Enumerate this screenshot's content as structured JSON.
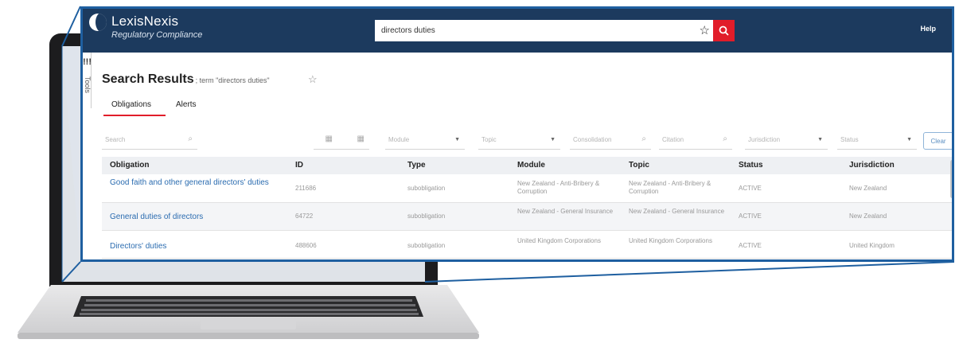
{
  "header": {
    "brand_name": "LexisNexis",
    "brand_sub": "Regulatory Compliance",
    "search_value": "directors duties",
    "help_label": "Help"
  },
  "side": {
    "mark": "!!!",
    "label": "Tools"
  },
  "page": {
    "title": "Search Results",
    "term": "; term \"directors duties\""
  },
  "tabs": [
    {
      "label": "Obligations"
    },
    {
      "label": "Alerts"
    }
  ],
  "filters": {
    "search": "Search",
    "module": "Module",
    "topic": "Topic",
    "consolidation": "Consolidation",
    "citation": "Citation",
    "jurisdiction": "Jurisdiction",
    "status": "Status",
    "clear": "Clear"
  },
  "table": {
    "columns": [
      "Obligation",
      "ID",
      "Type",
      "Module",
      "Topic",
      "Status",
      "Jurisdiction"
    ],
    "rows": [
      {
        "obligation": "Good faith and other general directors' duties",
        "id": "211686",
        "type": "subobligation",
        "module": "New Zealand - Anti-Bribery & Corruption",
        "topic": "New Zealand - Anti-Bribery & Corruption",
        "status": "ACTIVE",
        "jurisdiction": "New Zealand"
      },
      {
        "obligation": "General duties of directors",
        "id": "64722",
        "type": "subobligation",
        "module": "New Zealand - General Insurance",
        "topic": "New Zealand - General Insurance",
        "status": "ACTIVE",
        "jurisdiction": "New Zealand"
      },
      {
        "obligation": "Directors' duties",
        "id": "488606",
        "type": "subobligation",
        "module": "United Kingdom Corporations",
        "topic": "United Kingdom Corporations",
        "status": "ACTIVE",
        "jurisdiction": "United Kingdom"
      }
    ]
  },
  "colors": {
    "header_bg": "#1c3a5e",
    "accent_red": "#e11d2a",
    "link_blue": "#2b6cb0",
    "frame_blue": "#1e5fa0"
  }
}
